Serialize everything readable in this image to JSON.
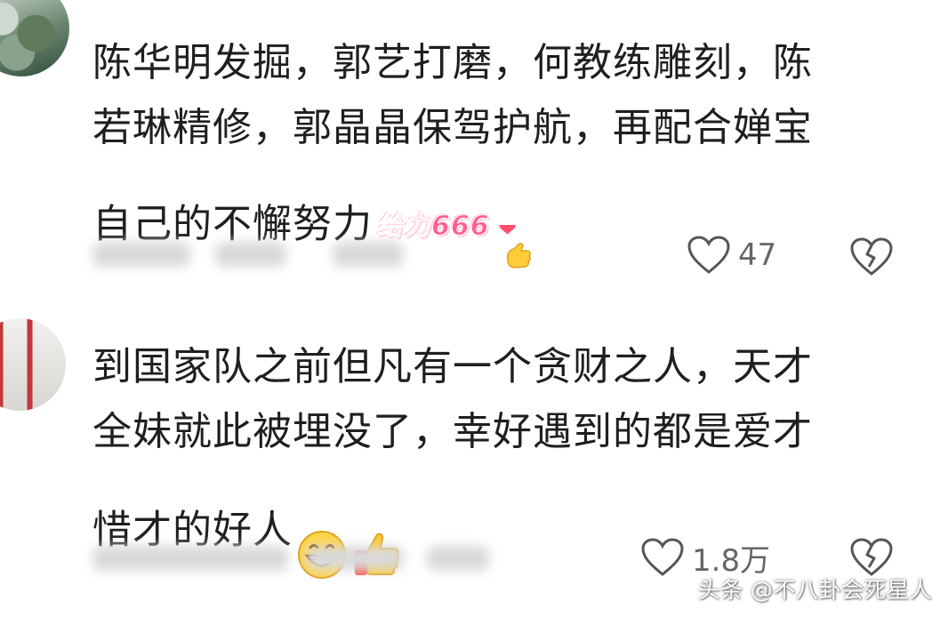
{
  "comments": [
    {
      "lines": [
        "陈华明发掘，郭艺打磨，何教练雕刻，陈",
        "若琳精修，郭晶晶保驾护航，再配合婵宝",
        "自己的不懈努力"
      ],
      "sticker_text": "给力666",
      "emoji": "finger-heart-emoji",
      "likes": "47",
      "accent": "#ff5f8e"
    },
    {
      "lines": [
        "到国家队之前但凡有一个贪财之人，天才",
        "全妹就此被埋没了，幸好遇到的都是爱才",
        "惜才的好人"
      ],
      "emoji": "grinning-face-emoji thumbs-up-emoji",
      "likes": "1.8万"
    }
  ],
  "watermark": "头条 @不八卦会死星人"
}
